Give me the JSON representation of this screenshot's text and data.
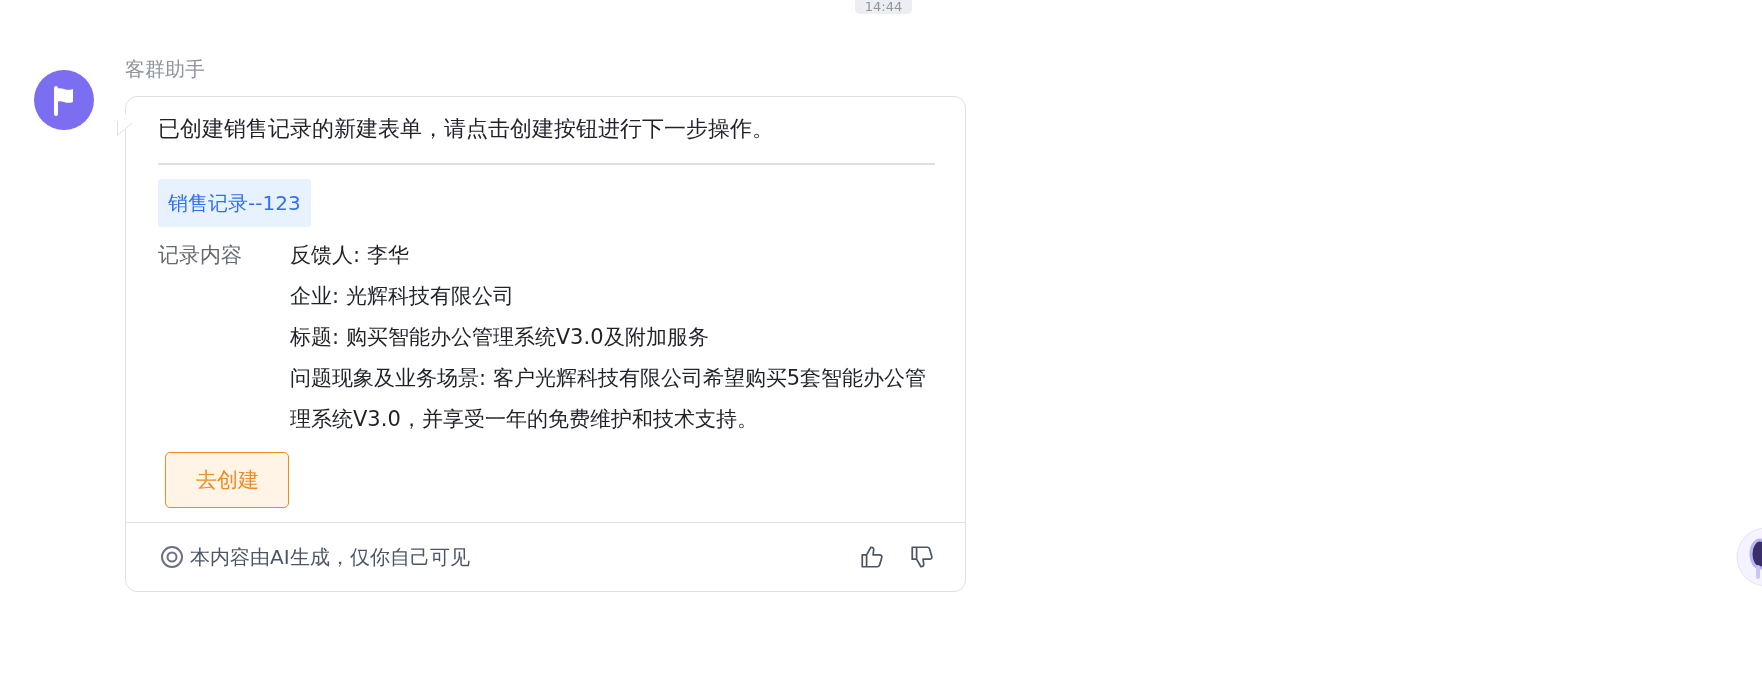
{
  "timestamp": "14:44",
  "message": {
    "sender": "客群助手",
    "intro": "已创建销售记录的新建表单，请点击创建按钮进行下一步操作。",
    "tag": "销售记录--123",
    "record_label": "记录内容",
    "record_lines": [
      "反馈人: 李华",
      "企业: 光辉科技有限公司",
      "标题: 购买智能办公管理系统V3.0及附加服务",
      "问题现象及业务场景: 客户光辉科技有限公司希望购买5套智能办公管理系统V3.0，并享受一年的免费维护和技术支持。"
    ],
    "button": "去创建",
    "footer_note": "本内容由AI生成，仅你自己可见"
  }
}
